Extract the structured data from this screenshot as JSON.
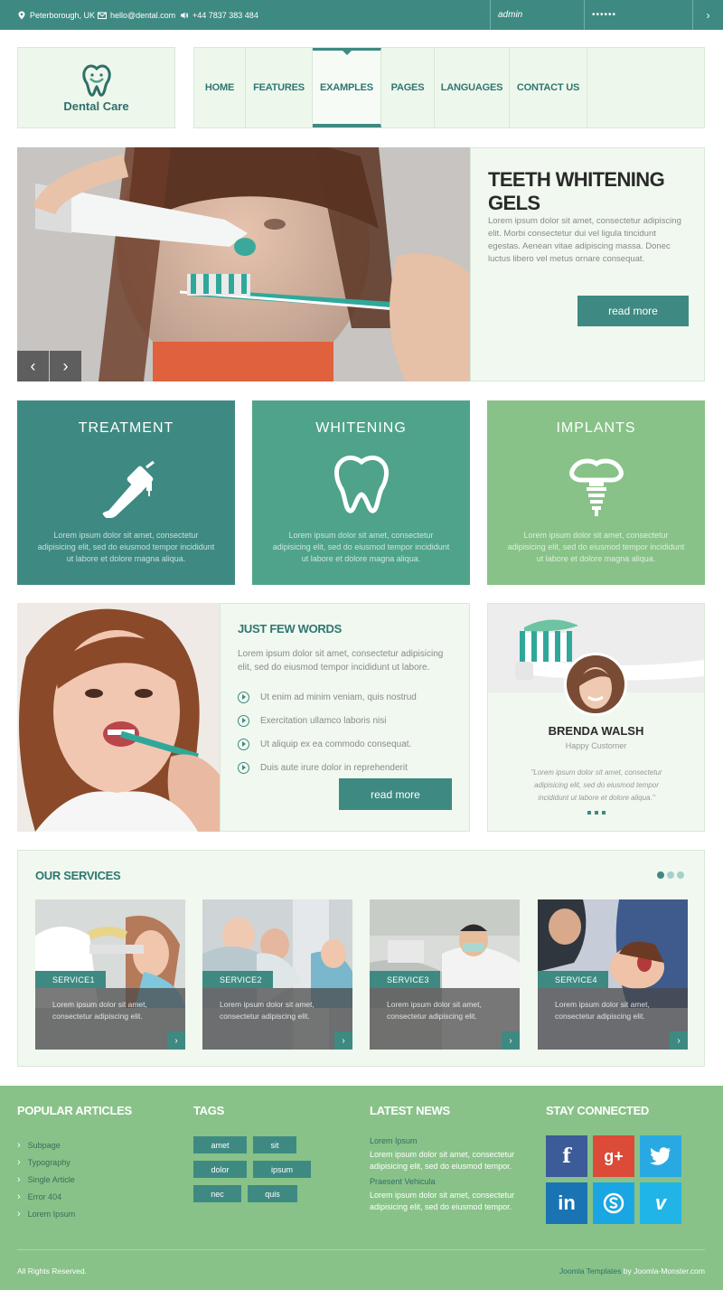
{
  "topbar": {
    "location": "Peterborough, UK",
    "email": "hello@dental.com",
    "phone": "+44 7837 383 484",
    "login_value": "admin",
    "password_value": "••••••",
    "go_symbol": "›"
  },
  "logo": {
    "text": "Dental Care"
  },
  "nav": {
    "items": [
      {
        "label": "HOME"
      },
      {
        "label": "FEATURES"
      },
      {
        "label": "EXAMPLES",
        "active": true
      },
      {
        "label": "PAGES"
      },
      {
        "label": "LANGUAGES"
      },
      {
        "label": "CONTACT US"
      }
    ]
  },
  "hero": {
    "title": "TEETH WHITENING GELS",
    "text": "Lorem ipsum dolor sit amet, consectetur adipiscing elit. Morbi consectetur dui vel ligula tincidunt egestas. Aenean vitae adipiscing massa. Donec luctus libero vel metus ornare consequat.",
    "button": "read more",
    "prev": "‹",
    "next": "›"
  },
  "features": [
    {
      "title": "TREATMENT",
      "icon": "dental-drill-icon",
      "color": "#3e8a82",
      "text": "Lorem ipsum dolor sit amet, consectetur adipisicing elit, sed do eiusmod tempor incididunt ut labore et dolore magna aliqua."
    },
    {
      "title": "WHITENING",
      "icon": "tooth-icon",
      "color": "#4fa38a",
      "text": "Lorem ipsum dolor sit amet, consectetur adipisicing elit, sed do eiusmod tempor incididunt ut labore et dolore magna aliqua."
    },
    {
      "title": "IMPLANTS",
      "icon": "implant-icon",
      "color": "#88c288",
      "text": "Lorem ipsum dolor sit amet, consectetur adipisicing elit, sed do eiusmod tempor incididunt ut labore et dolore magna aliqua."
    }
  ],
  "words": {
    "title": "JUST FEW WORDS",
    "text": "Lorem ipsum dolor sit amet, consectetur adipisicing elit, sed do eiusmod tempor incididunt ut labore.",
    "list": [
      "Ut enim ad minim veniam, quis nostrud",
      "Exercitation ullamco laboris nisi",
      "Ut aliquip ex ea commodo consequat.",
      "Duis aute irure dolor in reprehenderit"
    ],
    "button": "read more"
  },
  "testimonial": {
    "name": "BRENDA WALSH",
    "role": "Happy Customer",
    "quote": "\"Lorem ipsum dolor sit amet, consectetur adipisicing elit, sed do eiusmod tempor incididunt ut labore et dolore aliqua.\""
  },
  "services": {
    "title": "OUR SERVICES",
    "items": [
      {
        "label": "SERVICE1",
        "text": "Lorem ipsum dolor sit amet, consectetur adipiscing elit."
      },
      {
        "label": "SERVICE2",
        "text": "Lorem ipsum dolor sit amet, consectetur adipiscing elit."
      },
      {
        "label": "SERVICE3",
        "text": "Lorem ipsum dolor sit amet, consectetur adipiscing elit."
      },
      {
        "label": "SERVICE4",
        "text": "Lorem ipsum dolor sit amet, consectetur adipiscing elit."
      }
    ],
    "arrow": "›"
  },
  "footer": {
    "popular_title": "POPULAR ARTICLES",
    "popular": [
      "Subpage",
      "Typography",
      "Single Article",
      "Error 404",
      "Lorem Ipsum"
    ],
    "tags_title": "TAGS",
    "tags": [
      "amet",
      "sit",
      "dolor",
      "ipsum",
      "nec",
      "quis"
    ],
    "news_title": "LATEST NEWS",
    "news": [
      {
        "heading": "Lorem Ipsum",
        "text": "Lorem ipsum dolor sit amet, consectetur adipisicing elit, sed do eiusmod tempor."
      },
      {
        "heading": "Praesent Vehicula",
        "text": "Lorem ipsum dolor sit amet, consectetur adipisicing elit, sed do eiusmod tempor."
      }
    ],
    "social_title": "STAY CONNECTED",
    "social": [
      {
        "icon": "facebook-icon",
        "glyph": "f",
        "color": "#3b5b99"
      },
      {
        "icon": "google-plus-icon",
        "glyph": "g+",
        "color": "#dc4a38"
      },
      {
        "icon": "twitter-icon",
        "glyph": "t",
        "color": "#29a9e1"
      },
      {
        "icon": "linkedin-icon",
        "glyph": "in",
        "color": "#1a74b4"
      },
      {
        "icon": "skype-icon",
        "glyph": "S",
        "color": "#1aa6e3"
      },
      {
        "icon": "vimeo-icon",
        "glyph": "v",
        "color": "#21b4e6"
      }
    ],
    "copyright": "All Rights Reserved.",
    "credit_link": "Joomla Templates",
    "credit_rest": " by Joomla-Monster.com"
  },
  "colors": {
    "teal": "#3e8a82",
    "green": "#88c288",
    "mid_green": "#4fa38a",
    "panel": "#f0f8ef"
  }
}
